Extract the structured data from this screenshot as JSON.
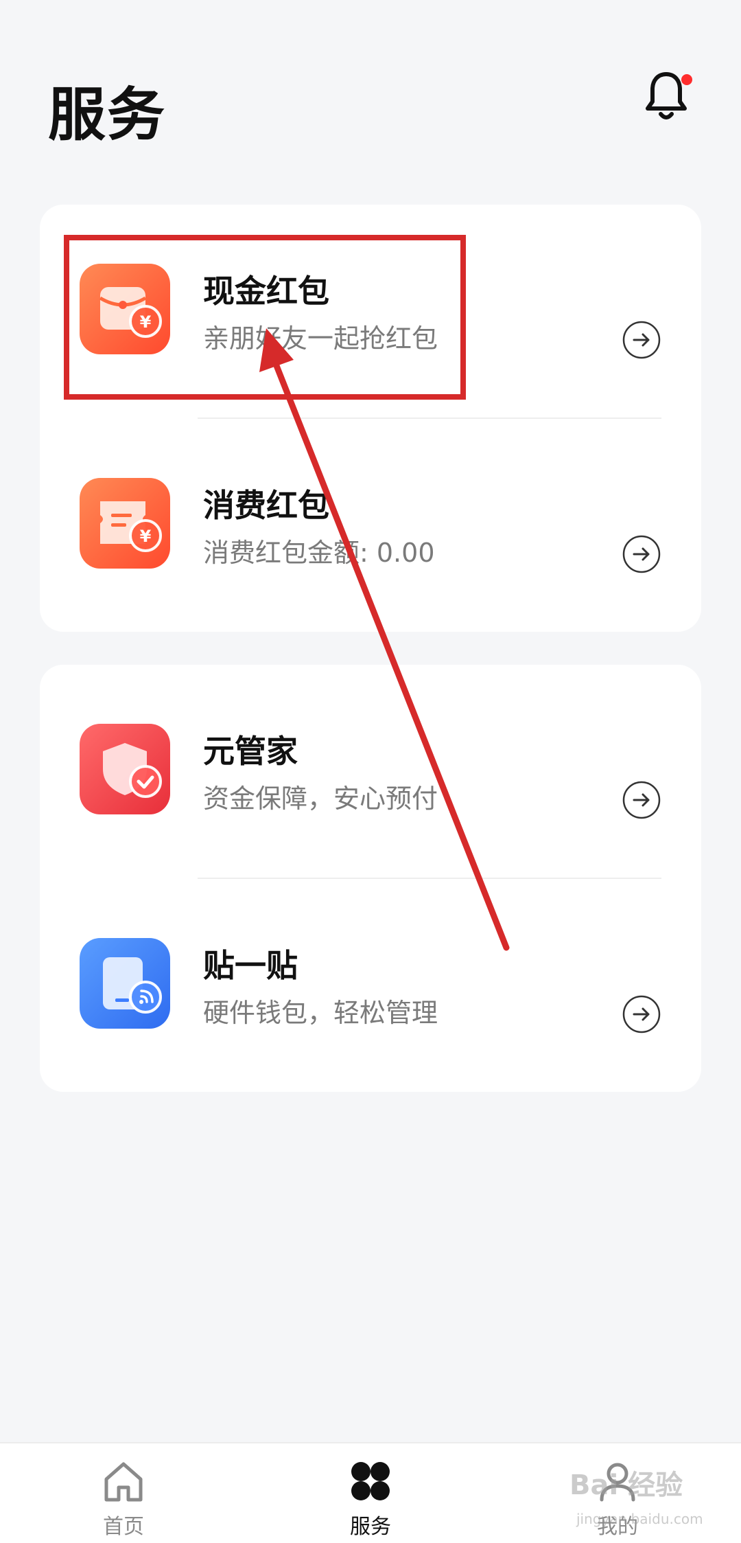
{
  "header": {
    "title": "服务",
    "notification_dot_color": "#ff2d2d"
  },
  "card1": {
    "items": [
      {
        "title": "现金红包",
        "subtitle": "亲朋好友一起抢红包",
        "icon": "red-envelope-yuan-icon"
      },
      {
        "title": "消费红包",
        "subtitle": "消费红包金额: 0.00",
        "icon": "voucher-yuan-icon"
      }
    ]
  },
  "card2": {
    "items": [
      {
        "title": "元管家",
        "subtitle": "资金保障，安心预付",
        "icon": "shield-check-icon"
      },
      {
        "title": "贴一贴",
        "subtitle": "硬件钱包，轻松管理",
        "icon": "nfc-card-icon"
      }
    ]
  },
  "tabbar": {
    "tabs": [
      {
        "label": "首页",
        "icon": "home-icon",
        "active": false
      },
      {
        "label": "服务",
        "icon": "services-grid-icon",
        "active": true
      },
      {
        "label": "我的",
        "icon": "user-icon",
        "active": false
      }
    ]
  },
  "watermark": {
    "text": "Bai 经验",
    "sub": "jingyan.baidu.com"
  },
  "colors": {
    "background": "#f5f6f8",
    "card": "#ffffff",
    "accent_orange": "#ff6a3d",
    "accent_red": "#f04848",
    "accent_blue": "#3d7dff",
    "annotation_red": "#d62a2a"
  }
}
